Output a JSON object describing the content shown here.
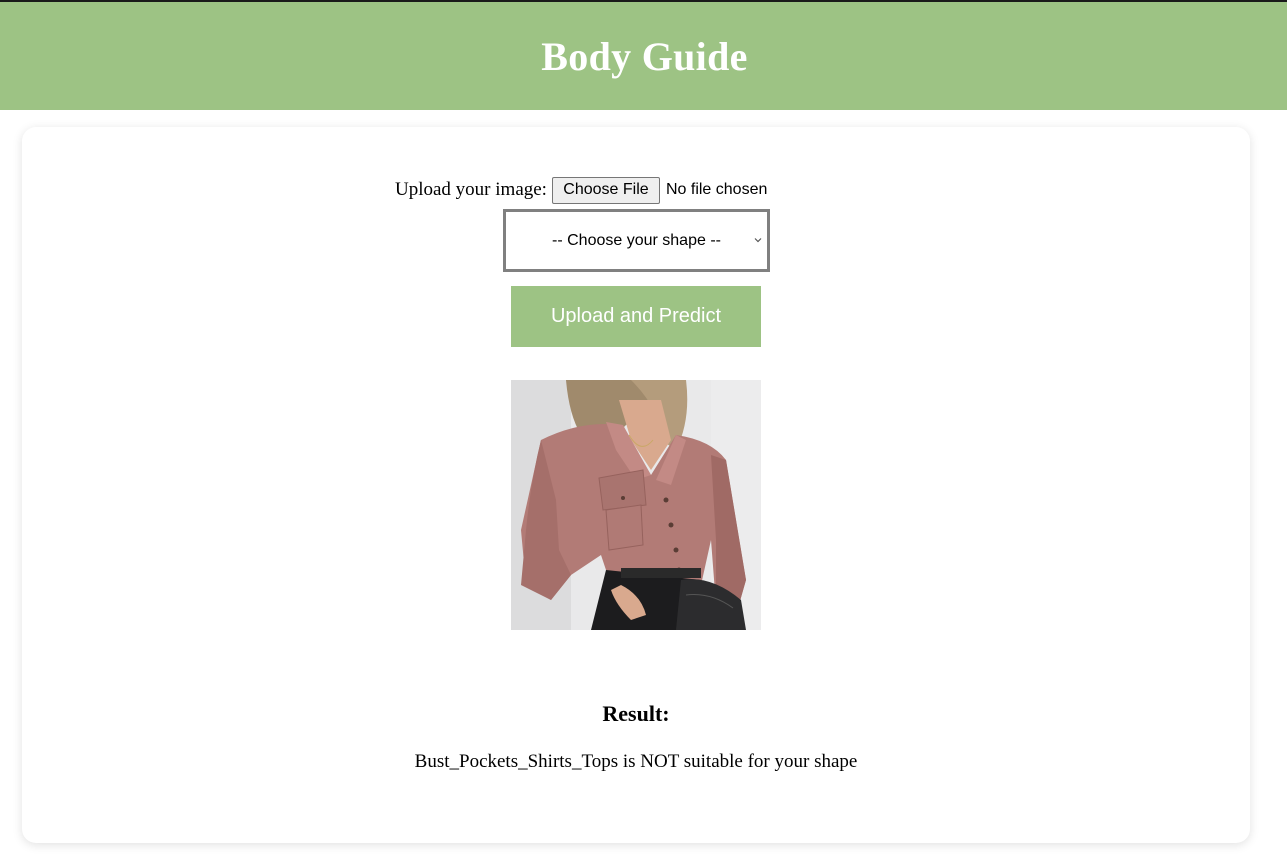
{
  "header": {
    "title": "Body Guide"
  },
  "form": {
    "upload_label": "Upload your image:",
    "file_button_label": "Choose File",
    "file_status": "No file chosen",
    "shape_select": {
      "selected": "-- Choose your shape --"
    },
    "submit_label": "Upload and Predict"
  },
  "preview": {
    "icon": "clothing-photo"
  },
  "result": {
    "heading": "Result:",
    "message": "Bust_Pockets_Shirts_Tops is NOT suitable for your shape"
  },
  "colors": {
    "accent": "#9dc384",
    "header_text": "#ffffff",
    "page_background": "#ffffff"
  }
}
